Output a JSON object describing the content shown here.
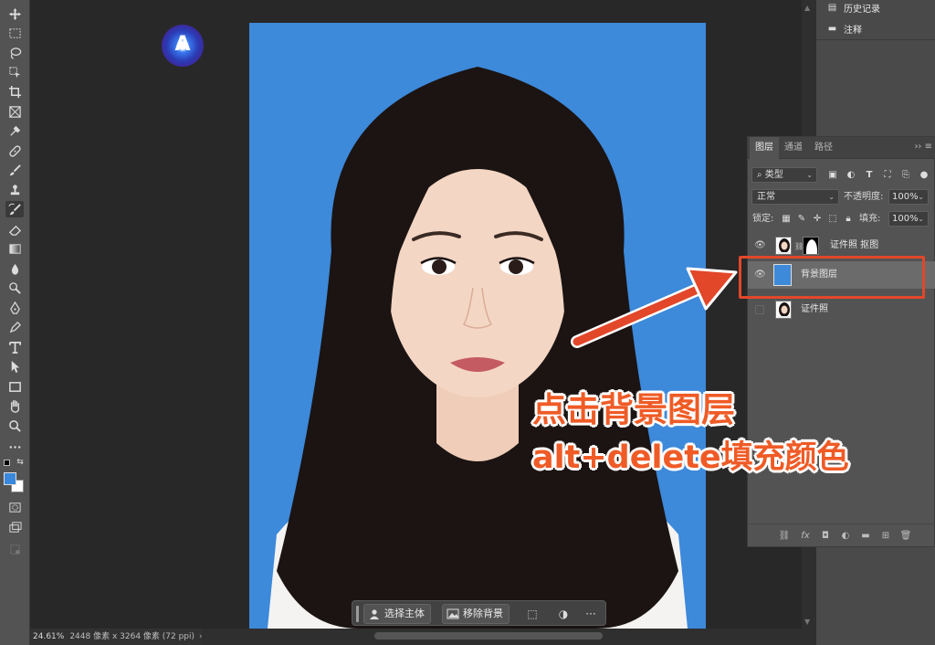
{
  "statusbar": {
    "zoom": "24.61%",
    "doc_info": "2448 像素 x 3264 像素 (72 ppi)"
  },
  "dock": {
    "history_label": "历史记录",
    "notes_label": "注释"
  },
  "layers_panel": {
    "tabs": [
      "图层",
      "通道",
      "路径"
    ],
    "filter_kind": "类型",
    "blend_mode": "正常",
    "opacity_label": "不透明度:",
    "opacity_value": "100%",
    "lock_label": "锁定:",
    "fill_label": "填充:",
    "fill_value": "100%",
    "layers": [
      {
        "name": "证件照 抠图",
        "visible": true,
        "selected": false,
        "has_mask": true
      },
      {
        "name": "背景图层",
        "visible": true,
        "selected": true,
        "fill_color": "#3d89da"
      },
      {
        "name": "证件照",
        "visible": false,
        "selected": false
      }
    ]
  },
  "context_bar": {
    "select_subject": "选择主体",
    "remove_background": "移除背景"
  },
  "annotation": {
    "line1": "点击背景图层",
    "line2": "alt+delete填充颜色",
    "color": "#ef5b26"
  },
  "colors": {
    "foreground": "#3a88dc",
    "background": "#ffffff",
    "photo_background": "#3d89da",
    "highlight_box": "#e2472a"
  }
}
